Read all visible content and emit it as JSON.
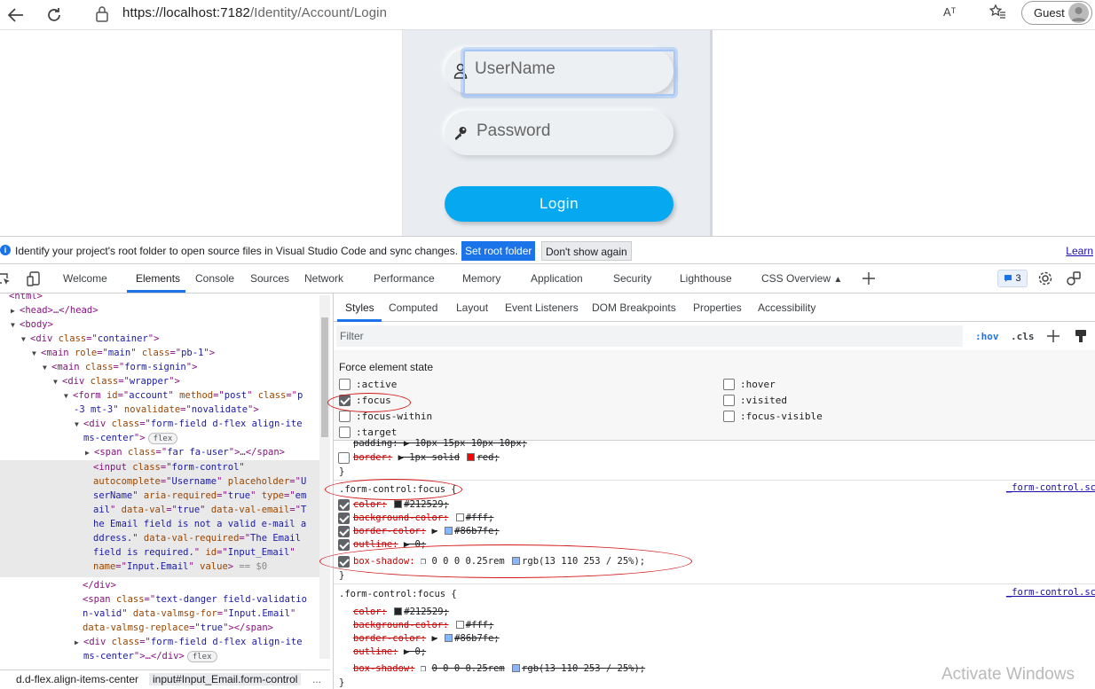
{
  "browser": {
    "url_host": "https://localhost:7182",
    "url_path": "/Identity/Account/Login",
    "read_aloud": "Aᵀ",
    "guest_label": "Guest"
  },
  "login": {
    "username_placeholder": "UserName",
    "password_placeholder": "Password",
    "login_label": "Login"
  },
  "infobar": {
    "message": "Identify your project's root folder to open source files in Visual Studio Code and sync changes.",
    "set_root": "Set root folder",
    "dont_show": "Don't show again",
    "learn": "Learn"
  },
  "devtools_tabs": [
    "Welcome",
    "Elements",
    "Console",
    "Sources",
    "Network",
    "Performance",
    "Memory",
    "Application",
    "Security",
    "Lighthouse",
    "CSS Overview"
  ],
  "issues_count": "3",
  "styles_tabs": [
    "Styles",
    "Computed",
    "Layout",
    "Event Listeners",
    "DOM Breakpoints",
    "Properties",
    "Accessibility"
  ],
  "filter_placeholder": "Filter",
  "hov": ":hov",
  "cls": ".cls",
  "force_state": {
    "title": "Force element state",
    "left": [
      {
        "label": ":active",
        "checked": false
      },
      {
        "label": ":focus",
        "checked": true
      },
      {
        "label": ":focus-within",
        "checked": false
      },
      {
        "label": ":target",
        "checked": false
      }
    ],
    "right": [
      {
        "label": ":hover",
        "checked": false
      },
      {
        "label": ":visited",
        "checked": false
      },
      {
        "label": ":focus-visible",
        "checked": false
      }
    ]
  },
  "dom": {
    "l0": "<html>",
    "l1a": "<head>",
    "l1b": "…</head>",
    "l2": "<body>",
    "l3": [
      "<div ",
      "class",
      "=\"",
      "container",
      "\">"
    ],
    "l4": [
      "<main ",
      "role",
      "=\"",
      "main",
      "\" ",
      "class",
      "=\"",
      "pb-1",
      "\">"
    ],
    "l5": [
      "<main ",
      "class",
      "=\"",
      "form-signin",
      "\">"
    ],
    "l6": [
      "<div ",
      "class",
      "=\"",
      "wrapper",
      "\">"
    ],
    "l7a": [
      "<form ",
      "id",
      "=\"",
      "account",
      "\" ",
      "method",
      "=\"",
      "post",
      "\" ",
      "class",
      "=\"",
      "p"
    ],
    "l7b": [
      "-3 mt-3",
      "\" ",
      "novalidate",
      "=\"",
      "novalidate",
      "\">"
    ],
    "l8a": [
      "<div ",
      "class",
      "=\"",
      "form-field d-flex align-ite"
    ],
    "l8b": [
      "ms-center",
      "\">"
    ],
    "flex": "flex",
    "l9": [
      "<span ",
      "class",
      "=\"",
      "far fa-user",
      "\">",
      "…</span>"
    ],
    "inp1": [
      "<input ",
      "class",
      "=\"",
      "form-control",
      "\""
    ],
    "inp2": [
      "autocomplete",
      "=\"",
      "Username",
      "\" ",
      "placeholder",
      "=\"",
      "U"
    ],
    "inp3": [
      "serName",
      "\" ",
      "aria-required",
      "=\"",
      "true",
      "\" ",
      "type",
      "=\"",
      "em"
    ],
    "inp4": [
      "ail",
      "\" ",
      "data-val",
      "=\"",
      "true",
      "\" ",
      "data-val-email",
      "=\"",
      "T"
    ],
    "inp5": [
      "he Email field is not a valid e-mail a"
    ],
    "inp6": [
      "ddress.",
      "\" ",
      "data-val-required",
      "=\"",
      "The Email"
    ],
    "inp7": [
      "field is required.",
      "\" ",
      "id",
      "=\"",
      "Input_Email",
      "\""
    ],
    "inp8": [
      "name",
      "=\"",
      "Input.Email",
      "\" ",
      "value",
      ">",
      " == $0"
    ],
    "div_close": "</div>",
    "sp1": [
      "<span ",
      "class",
      "=\"",
      "text-danger field-validatio"
    ],
    "sp2": [
      "n-valid",
      "\" ",
      "data-valmsg-for",
      "=\"",
      "Input.Email",
      "\""
    ],
    "sp3": [
      "data-valmsg-replace",
      "=\"",
      "true",
      "\">",
      "</span>"
    ],
    "d2a": [
      "<div ",
      "class",
      "=\"",
      "form-field d-flex align-ite"
    ],
    "d2b": [
      "ms-center",
      "\">",
      "…</div>"
    ]
  },
  "breadcrumbs": [
    "d.d-flex.align-items-center",
    "input#Input_Email.form-control",
    "..."
  ],
  "rules": {
    "partial_top": "padding: ▶ 10px 15px 10px 10px;",
    "border_prop": "border:",
    "border_val": "▶ 1px solid",
    "border_color": "red;",
    "close": "}",
    "r1_selector": ".form-control:focus {",
    "r1_link": "_form-control.sc",
    "color_prop": "color:",
    "color_val": "#212529;",
    "bg_prop": "background-color:",
    "bg_val": "#fff;",
    "bc_prop": "border-color:",
    "bc_val": "#86b7fe;",
    "outline_prop": "outline:",
    "outline_val": "▶ 0;",
    "bs_prop": "box-shadow:",
    "bs_val": "0 0 0 0.25rem",
    "bs_color": "rgb(13 110 253 / 25%);",
    "r2_selector": ".form-control:focus {",
    "r2_link": "_form-control.sc"
  },
  "swatch_colors": {
    "dark": "#212529",
    "white": "#ffffff",
    "blue": "#86b7fe",
    "red": "#ff0000",
    "shadow": "#8eb6f5"
  },
  "watermark": "Activate Windows"
}
